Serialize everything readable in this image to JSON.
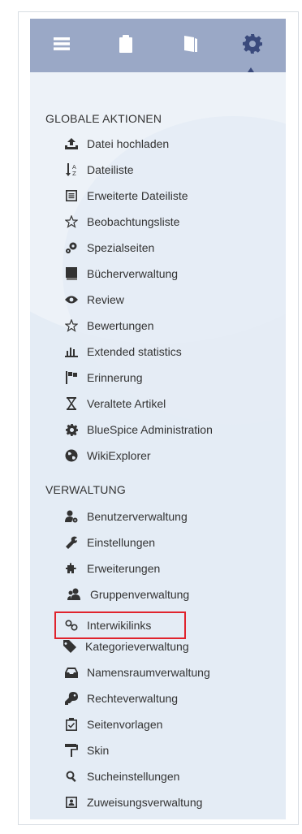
{
  "colors": {
    "toolbar_bg": "#9aa8c6",
    "panel_bg": "#e4ecf5",
    "highlight_border": "#e0232d",
    "active_tool": "#3a4a7c"
  },
  "toolbar": {
    "tools": [
      {
        "icon": "menu-icon"
      },
      {
        "icon": "clipboard-icon"
      },
      {
        "icon": "book-icon"
      },
      {
        "icon": "gear-icon",
        "active": true
      }
    ]
  },
  "sections": {
    "global": {
      "title": "GLOBALE AKTIONEN",
      "items": [
        {
          "label": "Datei hochladen",
          "icon": "upload-icon"
        },
        {
          "label": "Dateiliste",
          "icon": "sort-list-icon"
        },
        {
          "label": "Erweiterte Dateiliste",
          "icon": "list-box-icon"
        },
        {
          "label": "Beobachtungsliste",
          "icon": "star-outline-icon"
        },
        {
          "label": "Spezialseiten",
          "icon": "special-pages-icon"
        },
        {
          "label": "Bücherverwaltung",
          "icon": "book-manager-icon"
        },
        {
          "label": "Review",
          "icon": "eye-icon"
        },
        {
          "label": "Bewertungen",
          "icon": "star-outline-icon"
        },
        {
          "label": "Extended statistics",
          "icon": "bar-chart-icon"
        },
        {
          "label": "Erinnerung",
          "icon": "flag-icon"
        },
        {
          "label": "Veraltete Artikel",
          "icon": "hourglass-icon"
        },
        {
          "label": "BlueSpice Administration",
          "icon": "gear-icon"
        },
        {
          "label": "WikiExplorer",
          "icon": "globe-icon"
        }
      ]
    },
    "admin": {
      "title": "VERWALTUNG",
      "items": [
        {
          "label": "Benutzerverwaltung",
          "icon": "user-admin-icon"
        },
        {
          "label": "Einstellungen",
          "icon": "wrench-icon"
        },
        {
          "label": "Erweiterungen",
          "icon": "puzzle-icon"
        },
        {
          "label": "Gruppenverwaltung",
          "icon": "group-icon"
        },
        {
          "label": "Interwikilinks",
          "icon": "link-icon"
        },
        {
          "label": "Kategorieverwaltung",
          "icon": "tag-icon"
        },
        {
          "label": "Namensraumverwaltung",
          "icon": "inbox-icon"
        },
        {
          "label": "Rechteverwaltung",
          "icon": "key-icon"
        },
        {
          "label": "Seitenvorlagen",
          "icon": "template-icon"
        },
        {
          "label": "Skin",
          "icon": "paint-roller-icon"
        },
        {
          "label": "Sucheinstellungen",
          "icon": "search-icon"
        },
        {
          "label": "Zuweisungsverwaltung",
          "icon": "assignment-icon"
        }
      ]
    }
  }
}
